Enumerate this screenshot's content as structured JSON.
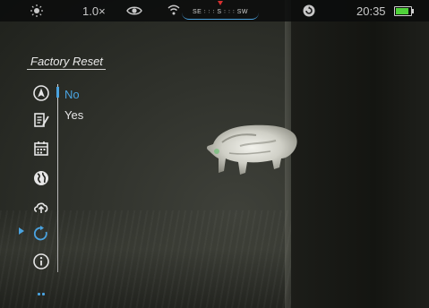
{
  "statusbar": {
    "zoom": "1.0×",
    "compass_labels": "SE ꞉ ꞉ ꞉ S ꞉ ꞉ ꞉ SW",
    "time": "20:35",
    "icons": [
      "sun-icon",
      "eye-icon",
      "wifi-icon",
      "stream-icon",
      "battery-icon"
    ],
    "battery_level": 0.85
  },
  "menu": {
    "title": "Factory Reset",
    "options": [
      {
        "label": "No",
        "selected": true
      },
      {
        "label": "Yes",
        "selected": false
      }
    ],
    "side_icons": [
      "navigation-icon",
      "notes-icon",
      "calendar-icon",
      "globe-icon",
      "cloud-upload-icon",
      "reset-icon",
      "info-icon"
    ],
    "active_icon": "reset-icon"
  },
  "colors": {
    "accent": "#4aa3e0",
    "text": "#e6e6e6",
    "battery": "#4fd23a",
    "compass_marker": "#d83030"
  }
}
